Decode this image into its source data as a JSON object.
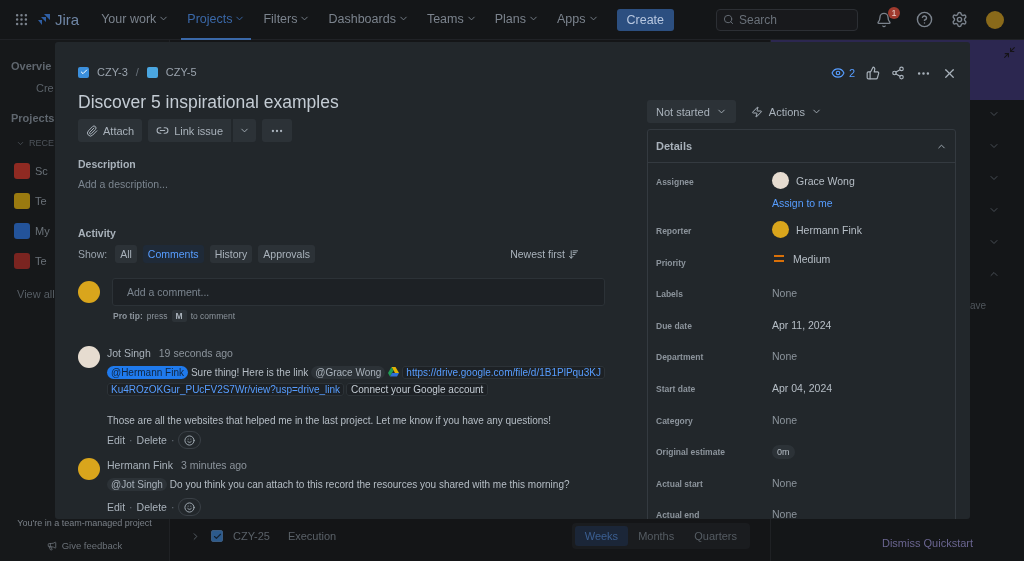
{
  "nav": {
    "product": "Jira",
    "items": [
      {
        "label": "Your work",
        "selected": false
      },
      {
        "label": "Projects",
        "selected": true
      },
      {
        "label": "Filters",
        "selected": false
      },
      {
        "label": "Dashboards",
        "selected": false
      },
      {
        "label": "Teams",
        "selected": false
      },
      {
        "label": "Plans",
        "selected": false
      },
      {
        "label": "Apps",
        "selected": false
      }
    ],
    "create": "Create",
    "search": {
      "placeholder": "Search"
    },
    "notification_count": "1"
  },
  "sidebar": {
    "overview": "Overvie",
    "create": "Cre",
    "projects": "Projects",
    "recent": "RECE",
    "recent_projects": [
      {
        "name": "Sc",
        "color": "#8f2a22"
      },
      {
        "name": "Te",
        "color": "#9a7a10"
      },
      {
        "name": "My",
        "color": "#23539a"
      },
      {
        "name": "Te",
        "color": "#7a2420"
      }
    ],
    "view_all": "View all",
    "footer": "You're in a team-managed project",
    "feedback": "Give feedback"
  },
  "background": {
    "row": {
      "key": "CZY-25",
      "summary": "Execution",
      "checked": true
    },
    "timescale": [
      {
        "label": "Weeks",
        "selected": true
      },
      {
        "label": "Months",
        "selected": false
      },
      {
        "label": "Quarters",
        "selected": false
      }
    ],
    "quickstart_text": "ave",
    "dismiss": "Dismiss Quickstart"
  },
  "issue": {
    "breadcrumbs": [
      {
        "key": "CZY-3",
        "kind": "task"
      },
      {
        "key": "CZY-5",
        "kind": "subtask"
      }
    ],
    "breadcrumb_separator": "/",
    "watchers": "2",
    "title": "Discover 5 inspirational examples",
    "attach": "Attach",
    "link_issue": "Link issue",
    "description": {
      "heading": "Description",
      "placeholder": "Add a description..."
    },
    "activity": {
      "heading": "Activity",
      "show_label": "Show:",
      "filters": [
        {
          "label": "All",
          "selected": false
        },
        {
          "label": "Comments",
          "selected": true
        },
        {
          "label": "History",
          "selected": false
        },
        {
          "label": "Approvals",
          "selected": false
        }
      ],
      "sort": "Newest first",
      "comment_placeholder": "Add a comment...",
      "pro_tip": {
        "label": "Pro tip:",
        "before": "press",
        "key": "M",
        "after": "to comment"
      },
      "comments": [
        {
          "author": "Jot Singh",
          "time": "19 seconds ago",
          "body": [
            {
              "kind": "mention",
              "text": "@Hermann Fink",
              "self": true
            },
            {
              "kind": "text",
              "text": "Sure thing! Here is the link"
            },
            {
              "kind": "mention",
              "text": "@Grace Wong",
              "self": false
            },
            {
              "kind": "link",
              "text": "https://drive.google.com/file/d/1B1PlPqu3KJ"
            },
            {
              "kind": "link_continued",
              "text": "Ku4ROzOKGur_PUcFV2S7Wr/view?usp=drive_link"
            },
            {
              "kind": "chip",
              "text": "Connect your Google account"
            }
          ],
          "paragraph": "Those are all the websites that helped me in the last project. Let me know if you have any questions!",
          "edit": "Edit",
          "separators": [
            "·",
            "·"
          ],
          "delete": "Delete"
        },
        {
          "author": "Hermann Fink",
          "time": "3 minutes ago",
          "body": [
            {
              "kind": "mention",
              "text": "@Jot Singh",
              "self": false
            },
            {
              "kind": "text",
              "text": "Do you think you can attach to this record the resources you shared with me this morning?"
            }
          ],
          "edit": "Edit",
          "separators": [
            "·",
            "·"
          ],
          "delete": "Delete"
        }
      ]
    },
    "status": "Not started",
    "actions": "Actions",
    "details": {
      "heading": "Details",
      "expanded": true,
      "fields": [
        {
          "label": "Assignee",
          "kind": "person",
          "value": "Grace Wong",
          "action": "Assign to me"
        },
        {
          "label": "Reporter",
          "kind": "person",
          "value": "Hermann Fink"
        },
        {
          "label": "Priority",
          "kind": "priority",
          "value": "Medium"
        },
        {
          "label": "Labels",
          "kind": "empty",
          "value": "None"
        },
        {
          "label": "Due date",
          "kind": "date",
          "value": "Apr 11, 2024"
        },
        {
          "label": "Department",
          "kind": "empty",
          "value": "None"
        },
        {
          "label": "Start date",
          "kind": "date",
          "value": "Apr 04, 2024"
        },
        {
          "label": "Category",
          "kind": "empty",
          "value": "None"
        },
        {
          "label": "Original estimate",
          "kind": "chip",
          "value": "0m"
        },
        {
          "label": "Actual start",
          "kind": "empty",
          "value": "None"
        },
        {
          "label": "Actual end",
          "kind": "empty",
          "value": "None"
        }
      ]
    }
  }
}
